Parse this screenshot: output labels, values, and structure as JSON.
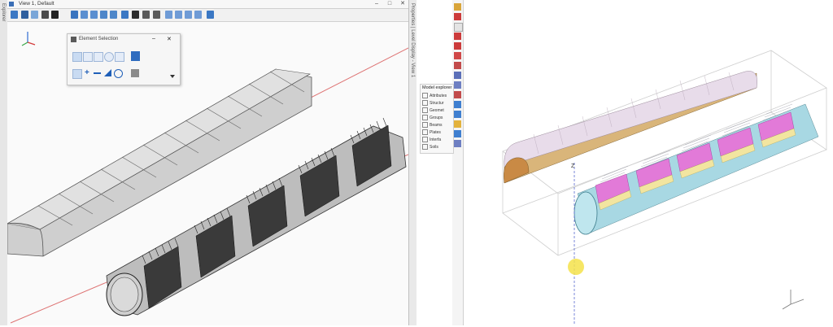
{
  "left_app": {
    "window_title": "View 1, Default",
    "left_panel_label": "Explorer",
    "right_panel_label": "Properties | Level Display - View 1",
    "window_buttons": {
      "minimize": "–",
      "maximize": "□",
      "close": "✕"
    },
    "element_selection": {
      "title": "Element Selection",
      "dialog_buttons": {
        "minimize": "–",
        "close": "✕"
      }
    },
    "colors": {
      "axis_line": "#d23a3a",
      "tunnel_outline": "#555555",
      "tunnel_fill": "#cfcfcf"
    }
  },
  "right_app": {
    "model_explorer": {
      "title": "Model explorer",
      "items": [
        "Attributes",
        "Structur",
        "Geomet",
        "Groups",
        "Beams",
        "Plates",
        "Interfa",
        "Soils"
      ]
    },
    "axis_label": "Z",
    "colors": {
      "lining_top": "#e27ad8",
      "shell": "#a8d8e3",
      "band": "#f2e5a0",
      "arch_fill": "#e8dcea",
      "arch_side": "#d9b57a",
      "cursor": "#f5e24a"
    }
  }
}
